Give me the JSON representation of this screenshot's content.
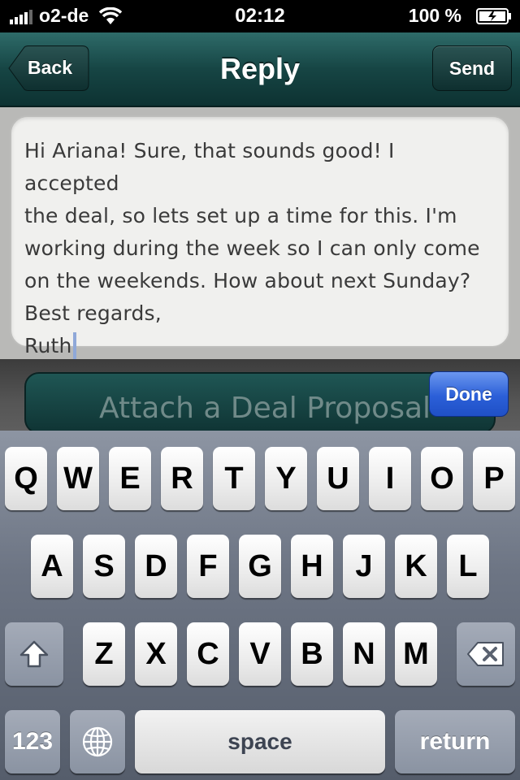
{
  "status_bar": {
    "carrier": "o2-de",
    "time": "02:12",
    "battery": "100 %"
  },
  "nav": {
    "title": "Reply",
    "back_label": "Back",
    "send_label": "Send"
  },
  "message": {
    "lines": [
      "Hi Ariana! Sure, that sounds good! I accepted",
      "the deal, so lets set up a time for this. I'm",
      "working during the week so I can only come",
      "on the weekends. How about next Sunday?",
      "Best regards,",
      "Ruth"
    ]
  },
  "attach": {
    "label": "Attach a Deal Proposal"
  },
  "done_label": "Done",
  "keyboard": {
    "row1": [
      "Q",
      "W",
      "E",
      "R",
      "T",
      "Y",
      "U",
      "I",
      "O",
      "P"
    ],
    "row2": [
      "A",
      "S",
      "D",
      "F",
      "G",
      "H",
      "J",
      "K",
      "L"
    ],
    "row3": [
      "Z",
      "X",
      "C",
      "V",
      "B",
      "N",
      "M"
    ],
    "numbers_label": "123",
    "space_label": "space",
    "return_label": "return"
  }
}
